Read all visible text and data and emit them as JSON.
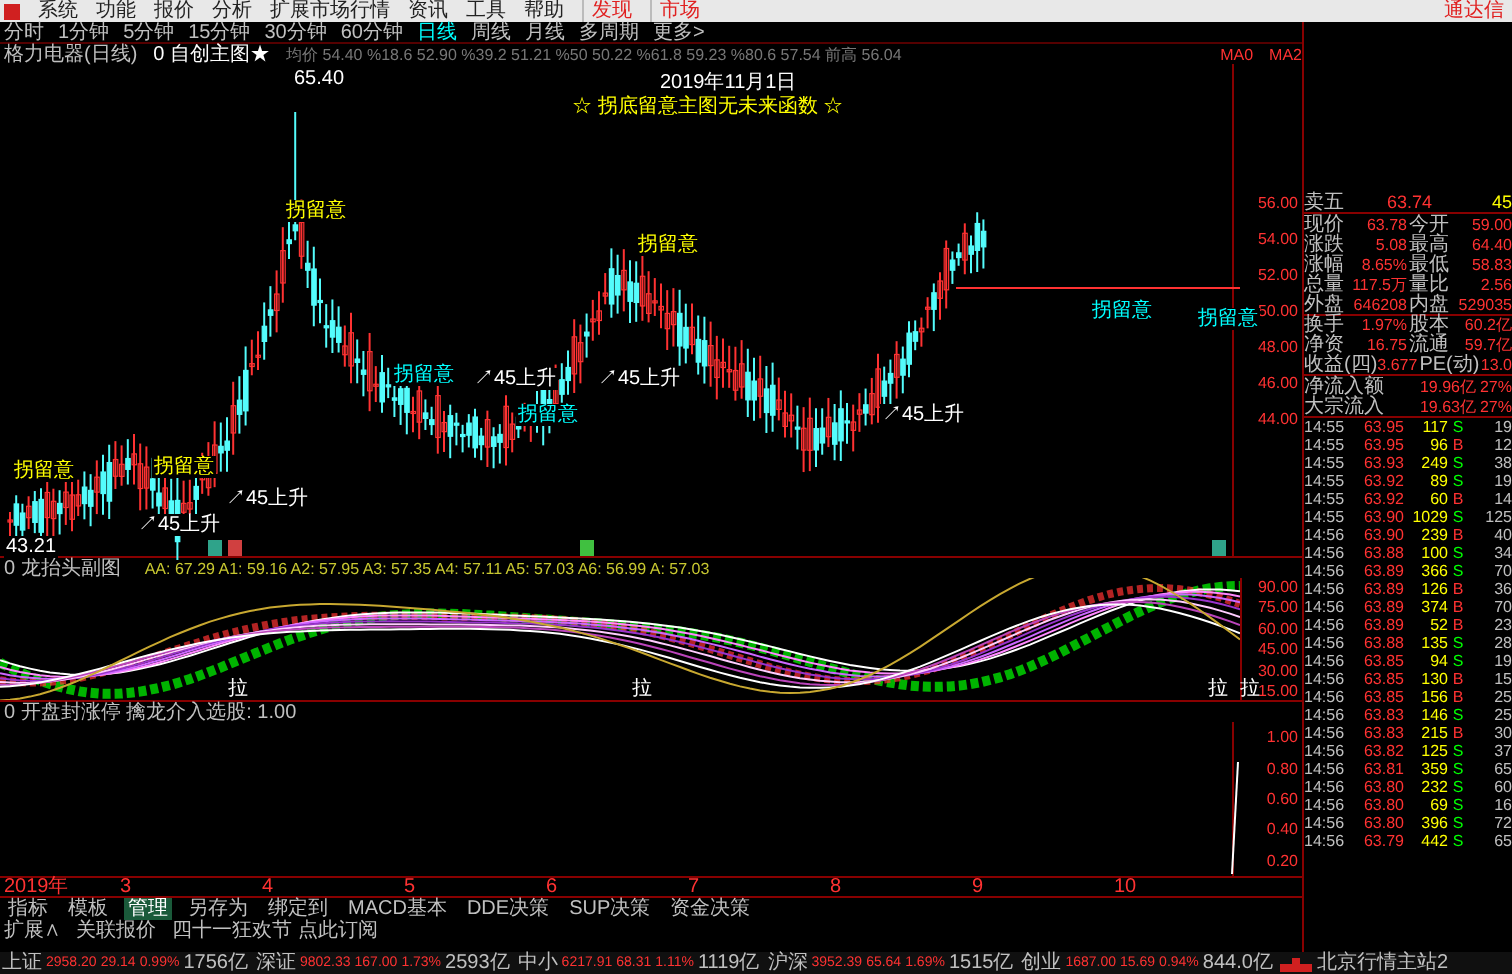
{
  "menu": [
    {
      "label": "系统",
      "kind": "plain"
    },
    {
      "label": "功能",
      "kind": "plain"
    },
    {
      "label": "报价",
      "kind": "plain"
    },
    {
      "label": "分析",
      "kind": "plain"
    },
    {
      "label": "扩展市场行情",
      "kind": "plain"
    },
    {
      "label": "资讯",
      "kind": "plain"
    },
    {
      "label": "工具",
      "kind": "plain"
    },
    {
      "label": "帮助",
      "kind": "plain"
    },
    {
      "label": "发现",
      "kind": "highlight"
    },
    {
      "label": "市场",
      "kind": "highlight"
    }
  ],
  "app_name": "通达信",
  "periods": [
    {
      "label": "分时",
      "selected": false
    },
    {
      "label": "1分钟",
      "selected": false
    },
    {
      "label": "5分钟",
      "selected": false
    },
    {
      "label": "15分钟",
      "selected": false
    },
    {
      "label": "30分钟",
      "selected": false
    },
    {
      "label": "60分钟",
      "selected": false
    },
    {
      "label": "日线",
      "selected": true
    },
    {
      "label": "周线",
      "selected": false
    },
    {
      "label": "月线",
      "selected": false
    },
    {
      "label": "多周期",
      "selected": false
    },
    {
      "label": "更多>",
      "selected": false
    }
  ],
  "main_chart": {
    "stock": "格力电器(日线)",
    "formula": "0 自创主图★",
    "values": "均价 54.40 %18.6 52.90 %39.2 51.21 %50 50.22 %61.8 59.23 %80.6 57.54 前高 56.04",
    "ma_labels": [
      "MA0",
      "MA2"
    ],
    "date_label": "2019年11月1日",
    "banner": "☆ 拐底留意主图无未来函数 ☆",
    "annotations": [
      {
        "text": "65.40",
        "color": "#ffffff"
      },
      {
        "text": "拐留意",
        "color": "#ffff00"
      },
      {
        "text": "拐留意",
        "color": "#ffff00"
      },
      {
        "text": "拐留意",
        "color": "#ffff00"
      },
      {
        "text": "拐留意",
        "color": "#ffff00"
      },
      {
        "text": "↗45上升",
        "color": "#ffffff"
      },
      {
        "text": "↗45上升",
        "color": "#ffffff"
      },
      {
        "text": "拐留意",
        "color": "#00ffff"
      },
      {
        "text": "↗45上升",
        "color": "#ffffff"
      },
      {
        "text": "↗45上升",
        "color": "#ffffff"
      },
      {
        "text": "拐留意",
        "color": "#00ffff"
      },
      {
        "text": "↗45上升",
        "color": "#ffffff"
      },
      {
        "text": "43.21",
        "color": "#ffffff"
      },
      {
        "text": "拐留意",
        "color": "#00ffff"
      },
      {
        "text": "拐留意",
        "color": "#00ffff"
      }
    ],
    "axis": [
      "56.00",
      "54.00",
      "52.00",
      "50.00",
      "48.00",
      "46.00",
      "44.00"
    ]
  },
  "sub_chart": {
    "title": "0 龙抬头副图",
    "values": "AA: 67.29  A1: 59.16  A2: 57.95  A3: 57.35  A4: 57.11  A5: 57.03  A6: 56.99  A: 57.03",
    "signals": [
      "拉",
      "拉",
      "拉",
      "拉"
    ],
    "axis": [
      "90.00",
      "75.00",
      "60.00",
      "45.00",
      "30.00",
      "15.00"
    ]
  },
  "third_chart": {
    "title": "0 开盘封涨停 擒龙介入选股: 1.00",
    "axis": [
      "1.00",
      "0.80",
      "0.60",
      "0.40",
      "0.20"
    ]
  },
  "date_axis": [
    "2019年",
    "3",
    "4",
    "5",
    "6",
    "7",
    "8",
    "9",
    "10"
  ],
  "bottom_tabs": [
    {
      "label": "指标",
      "selected": false
    },
    {
      "label": "模板",
      "selected": false
    },
    {
      "label": "管理",
      "selected": true
    },
    {
      "label": "另存为",
      "selected": false
    },
    {
      "label": "绑定到",
      "selected": false
    },
    {
      "label": "MACD基本",
      "selected": false
    },
    {
      "label": "DDE决策",
      "selected": false
    },
    {
      "label": "SUP决策",
      "selected": false
    },
    {
      "label": "资金决策",
      "selected": false
    }
  ],
  "bottom_links": [
    "扩展∧",
    "关联报价",
    "四十一狂欢节 点此订阅"
  ],
  "quote": {
    "ask5": {
      "label": "卖五",
      "price": "63.74",
      "volume": "45"
    },
    "rows": [
      {
        "l1": "现价",
        "v1": "63.78",
        "l2": "今开",
        "v2": "59.00"
      },
      {
        "l1": "涨跌",
        "v1": "5.08",
        "l2": "最高",
        "v2": "64.40"
      },
      {
        "l1": "涨幅",
        "v1": "8.65%",
        "l2": "最低",
        "v2": "58.83"
      },
      {
        "l1": "总量",
        "v1": "117.5万",
        "l2": "量比",
        "v2": "2.56"
      },
      {
        "l1": "外盘",
        "v1": "646208",
        "l2": "内盘",
        "v2": "529035"
      },
      {
        "l1": "换手",
        "v1": "1.97%",
        "l2": "股本",
        "v2": "60.2亿"
      },
      {
        "l1": "净资",
        "v1": "16.75",
        "l2": "流通",
        "v2": "59.7亿"
      },
      {
        "l1": "收益(四)",
        "v1": "3.677",
        "l2": "PE(动)",
        "v2": "13.0"
      }
    ],
    "flows": [
      {
        "label": "净流入额",
        "value": "19.96亿",
        "pct": "27%"
      },
      {
        "label": "大宗流入",
        "value": "19.63亿",
        "pct": "27%"
      }
    ]
  },
  "ticks": [
    {
      "time": "14:55",
      "price": "63.95",
      "volume": "117",
      "side": "S",
      "count": "19"
    },
    {
      "time": "14:55",
      "price": "63.95",
      "volume": "96",
      "side": "B",
      "count": "12"
    },
    {
      "time": "14:55",
      "price": "63.93",
      "volume": "249",
      "side": "S",
      "count": "38"
    },
    {
      "time": "14:55",
      "price": "63.92",
      "volume": "89",
      "side": "S",
      "count": "19"
    },
    {
      "time": "14:55",
      "price": "63.92",
      "volume": "60",
      "side": "B",
      "count": "14"
    },
    {
      "time": "14:55",
      "price": "63.90",
      "volume": "1029",
      "side": "S",
      "count": "125"
    },
    {
      "time": "14:56",
      "price": "63.90",
      "volume": "239",
      "side": "B",
      "count": "40"
    },
    {
      "time": "14:56",
      "price": "63.88",
      "volume": "100",
      "side": "S",
      "count": "34"
    },
    {
      "time": "14:56",
      "price": "63.89",
      "volume": "366",
      "side": "S",
      "count": "70"
    },
    {
      "time": "14:56",
      "price": "63.89",
      "volume": "126",
      "side": "B",
      "count": "36"
    },
    {
      "time": "14:56",
      "price": "63.89",
      "volume": "374",
      "side": "B",
      "count": "70"
    },
    {
      "time": "14:56",
      "price": "63.89",
      "volume": "52",
      "side": "B",
      "count": "23"
    },
    {
      "time": "14:56",
      "price": "63.88",
      "volume": "135",
      "side": "S",
      "count": "28"
    },
    {
      "time": "14:56",
      "price": "63.85",
      "volume": "94",
      "side": "S",
      "count": "19"
    },
    {
      "time": "14:56",
      "price": "63.85",
      "volume": "130",
      "side": "B",
      "count": "15"
    },
    {
      "time": "14:56",
      "price": "63.85",
      "volume": "156",
      "side": "B",
      "count": "25"
    },
    {
      "time": "14:56",
      "price": "63.83",
      "volume": "146",
      "side": "S",
      "count": "25"
    },
    {
      "time": "14:56",
      "price": "63.83",
      "volume": "215",
      "side": "B",
      "count": "30"
    },
    {
      "time": "14:56",
      "price": "63.82",
      "volume": "125",
      "side": "S",
      "count": "37"
    },
    {
      "time": "14:56",
      "price": "63.81",
      "volume": "359",
      "side": "S",
      "count": "65"
    },
    {
      "time": "14:56",
      "price": "63.80",
      "volume": "232",
      "side": "S",
      "count": "60"
    },
    {
      "time": "14:56",
      "price": "63.80",
      "volume": "69",
      "side": "S",
      "count": "16"
    },
    {
      "time": "14:56",
      "price": "63.80",
      "volume": "396",
      "side": "S",
      "count": "72"
    },
    {
      "time": "14:56",
      "price": "63.79",
      "volume": "442",
      "side": "S",
      "count": "65"
    }
  ],
  "status_bar": {
    "indices": [
      {
        "name": "上证",
        "value": "2958.20",
        "change": "29.14",
        "pct": "0.99%",
        "amount": "1756亿"
      },
      {
        "name": "深证",
        "value": "9802.33",
        "change": "167.00",
        "pct": "1.73%",
        "amount": "2593亿"
      },
      {
        "name": "中小",
        "value": "6217.91",
        "change": "68.31",
        "pct": "1.11%",
        "amount": "1119亿"
      },
      {
        "name": "沪深",
        "value": "3952.39",
        "change": "65.64",
        "pct": "1.69%",
        "amount": "1515亿"
      },
      {
        "name": "创业",
        "value": "1687.00",
        "change": "15.69",
        "pct": "0.94%",
        "amount": "844.0亿"
      }
    ],
    "server": "北京行情主站2"
  }
}
